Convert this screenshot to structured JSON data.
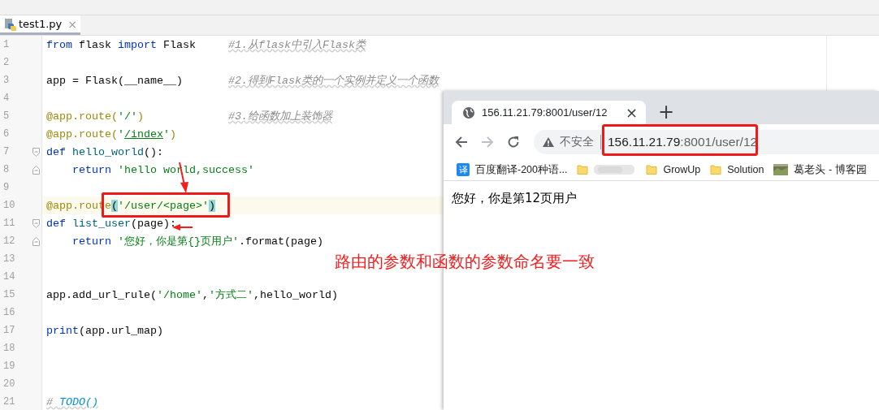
{
  "editor": {
    "tab": {
      "label": "test1.py",
      "close": "×",
      "selected": true
    },
    "lines": [
      {
        "number": "1",
        "current": false,
        "fold_start": false,
        "fold_end": false,
        "tokens": [
          {
            "kind": "keyword",
            "text": "from"
          },
          {
            "kind": "plain",
            "text": " flask "
          },
          {
            "kind": "keyword",
            "text": "import"
          },
          {
            "kind": "plain",
            "text": " Flask     "
          },
          {
            "kind": "comment",
            "text": "#1.从flask中引入Flask类"
          }
        ]
      },
      {
        "number": "2",
        "current": false,
        "fold_start": false,
        "fold_end": false
      },
      {
        "number": "3",
        "current": false,
        "fold_start": false,
        "fold_end": false,
        "tokens": [
          {
            "kind": "plain",
            "text": "app = Flask(__name__)       "
          },
          {
            "kind": "comment",
            "text": "#2.得到Flask类的一个实例并定义一个函数"
          }
        ]
      },
      {
        "number": "4",
        "current": false,
        "fold_start": false,
        "fold_end": false
      },
      {
        "number": "5",
        "current": false,
        "fold_start": false,
        "fold_end": false,
        "tokens": [
          {
            "kind": "decorator",
            "text": "@app.route("
          },
          {
            "kind": "string",
            "text": "'/'"
          },
          {
            "kind": "decorator",
            "text": ")             "
          },
          {
            "kind": "comment",
            "text": "#3.给函数加上装饰器"
          }
        ]
      },
      {
        "number": "6",
        "current": false,
        "fold_start": false,
        "fold_end": false,
        "tokens": [
          {
            "kind": "decorator",
            "text": "@app.route("
          },
          {
            "kind": "string",
            "text": "'"
          },
          {
            "kind": "link",
            "text": "/index"
          },
          {
            "kind": "string",
            "text": "'"
          },
          {
            "kind": "decorator",
            "text": ")"
          }
        ]
      },
      {
        "number": "7",
        "current": false,
        "fold_start": true,
        "fold_end": false,
        "tokens": [
          {
            "kind": "keyword",
            "text": "def "
          },
          {
            "kind": "funcname",
            "text": "hello_world"
          },
          {
            "kind": "plain",
            "text": "():"
          }
        ]
      },
      {
        "number": "8",
        "current": false,
        "fold_start": false,
        "fold_end": true,
        "tokens": [
          {
            "kind": "keyword",
            "text": "    return "
          },
          {
            "kind": "string",
            "text": "'hello world,success'"
          }
        ]
      },
      {
        "number": "9",
        "current": false,
        "fold_start": false,
        "fold_end": false
      },
      {
        "number": "10",
        "current": true,
        "fold_start": false,
        "fold_end": false,
        "tokens": [
          {
            "kind": "decorator",
            "text": "@app.route"
          },
          {
            "kind": "paren_match",
            "text": "("
          },
          {
            "kind": "string",
            "text": "'/user/<page>'"
          },
          {
            "kind": "paren_match",
            "text": ")"
          }
        ]
      },
      {
        "number": "11",
        "current": false,
        "fold_start": true,
        "fold_end": false,
        "tokens": [
          {
            "kind": "keyword",
            "text": "def "
          },
          {
            "kind": "funcname",
            "text": "list_user"
          },
          {
            "kind": "plain",
            "text": "(page):"
          }
        ]
      },
      {
        "number": "12",
        "current": false,
        "fold_start": false,
        "fold_end": true,
        "tokens": [
          {
            "kind": "keyword",
            "text": "    return "
          },
          {
            "kind": "string",
            "text": "'您好，你是第{}页用户'"
          },
          {
            "kind": "plain",
            "text": ".format(page)"
          }
        ]
      },
      {
        "number": "13",
        "current": false,
        "fold_start": false,
        "fold_end": false
      },
      {
        "number": "14",
        "current": false,
        "fold_start": false,
        "fold_end": false
      },
      {
        "number": "15",
        "current": false,
        "fold_start": false,
        "fold_end": false,
        "tokens": [
          {
            "kind": "plain",
            "text": "app.add_url_rule("
          },
          {
            "kind": "string",
            "text": "'/home'"
          },
          {
            "kind": "plain",
            "text": ","
          },
          {
            "kind": "string",
            "text": "'方式二'"
          },
          {
            "kind": "plain",
            "text": ",hello_world)"
          }
        ]
      },
      {
        "number": "16",
        "current": false,
        "fold_start": false,
        "fold_end": false
      },
      {
        "number": "17",
        "current": false,
        "fold_start": false,
        "fold_end": false,
        "tokens": [
          {
            "kind": "keyword",
            "text": "print"
          },
          {
            "kind": "plain",
            "text": "(app.url_map)"
          }
        ]
      },
      {
        "number": "18",
        "current": false,
        "fold_start": false,
        "fold_end": false
      },
      {
        "number": "19",
        "current": false,
        "fold_start": false,
        "fold_end": false
      },
      {
        "number": "20",
        "current": false,
        "fold_start": false,
        "fold_end": false
      },
      {
        "number": "21",
        "current": false,
        "fold_start": false,
        "fold_end": false,
        "tokens": [
          {
            "kind": "comment",
            "text": "# "
          },
          {
            "kind": "todo",
            "text": "TODO()"
          }
        ]
      }
    ]
  },
  "browser": {
    "tab": {
      "title": "156.11.21.79:8001/user/12",
      "close": "×"
    },
    "new_tab": "+",
    "address": {
      "security": "不安全",
      "host": "156.11.21.79",
      "path": ":8001/user/12"
    },
    "bookmarks": [
      {
        "kind": "translate",
        "icon_text": "译",
        "label": "百度翻译-200种语..."
      },
      {
        "kind": "blurred"
      },
      {
        "kind": "folder",
        "label": "GrowUp"
      },
      {
        "kind": "folder",
        "label": "Solution"
      },
      {
        "kind": "site",
        "label": "葛老头 - 博客园"
      }
    ],
    "content": "您好，你是第12页用户"
  },
  "annotation": {
    "text": "路由的参数和函数的参数命名要一致"
  }
}
